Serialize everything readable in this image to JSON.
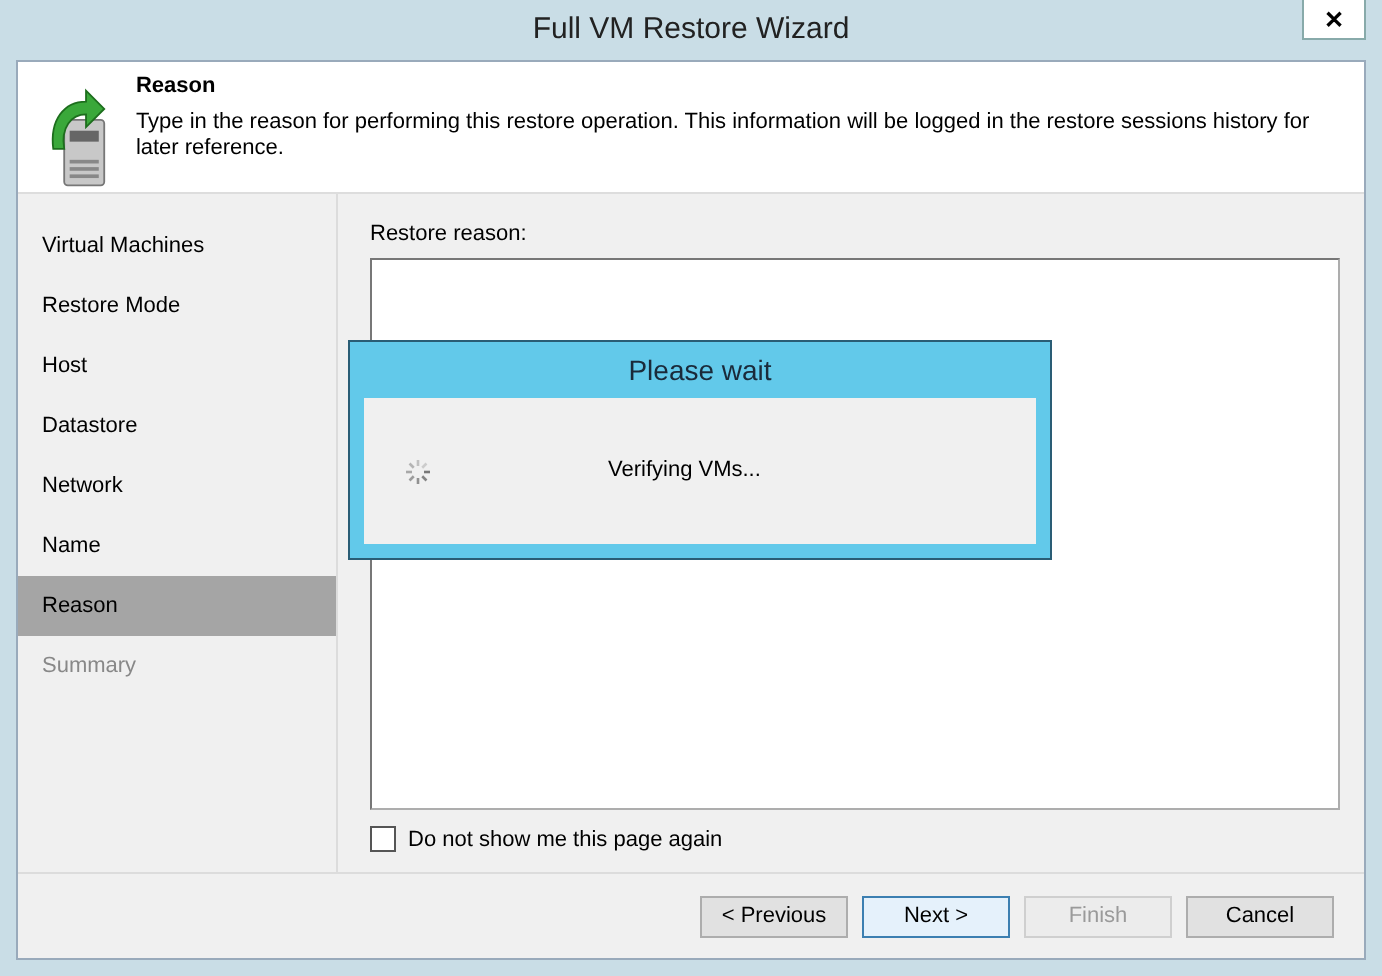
{
  "window": {
    "title": "Full VM Restore Wizard",
    "close_glyph": "✕"
  },
  "header": {
    "title": "Reason",
    "description": "Type in the reason for performing this restore operation. This information will be logged in the restore sessions history for later reference."
  },
  "steps": [
    {
      "label": "Virtual Machines",
      "selected": false,
      "disabled": false
    },
    {
      "label": "Restore Mode",
      "selected": false,
      "disabled": false
    },
    {
      "label": "Host",
      "selected": false,
      "disabled": false
    },
    {
      "label": "Datastore",
      "selected": false,
      "disabled": false
    },
    {
      "label": "Network",
      "selected": false,
      "disabled": false
    },
    {
      "label": "Name",
      "selected": false,
      "disabled": false
    },
    {
      "label": "Reason",
      "selected": true,
      "disabled": false
    },
    {
      "label": "Summary",
      "selected": false,
      "disabled": true
    }
  ],
  "reason": {
    "label": "Restore reason:"
  },
  "dont_show": {
    "label": "Do not show me this page again",
    "checked": false
  },
  "buttons": [
    {
      "label": "< Previous",
      "disabled": false,
      "focused": false
    },
    {
      "label": "Next >",
      "disabled": false,
      "focused": true
    },
    {
      "label": "Finish",
      "disabled": true,
      "focused": false
    },
    {
      "label": "Cancel",
      "disabled": false,
      "focused": false
    }
  ],
  "dialog": {
    "title": "Please wait",
    "message": "Verifying VMs..."
  }
}
